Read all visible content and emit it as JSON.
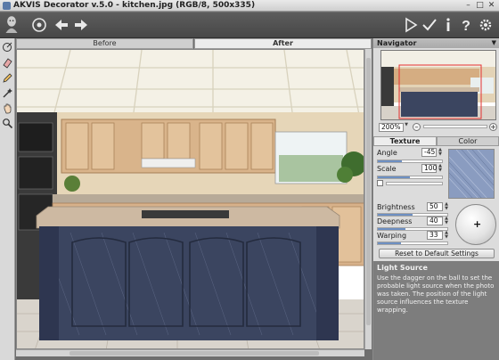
{
  "window": {
    "title": "AKVIS Decorator v.5.0 - kitchen.jpg (RGB/8, 500x335)",
    "controls": [
      "minimize",
      "maximize",
      "close"
    ]
  },
  "toolbar": {
    "left_icons": [
      "akvis-logo-icon",
      "scan-icon",
      "undo-icon",
      "redo-icon"
    ],
    "right_icons": [
      "run-icon",
      "apply-icon",
      "info-icon",
      "help-icon",
      "settings-icon"
    ]
  },
  "left_tools": [
    "decorate-brush-icon",
    "eraser-icon",
    "pencil-icon",
    "magic-wand-icon",
    "hand-icon",
    "zoom-icon"
  ],
  "view_tabs": {
    "before": "Before",
    "after": "After",
    "active": "After"
  },
  "navigator": {
    "title": "Navigator",
    "zoom": "200%"
  },
  "settings": {
    "tabs": {
      "texture": "Texture",
      "color": "Color",
      "active": "Texture"
    },
    "angle_label": "Angle",
    "angle_value": "-45",
    "angle_fraction": 0.38,
    "scale_label": "Scale",
    "scale_value": "100",
    "scale_fraction": 0.5,
    "brightness_label": "Brightness",
    "brightness_value": "50",
    "brightness_fraction": 0.5,
    "deepness_label": "Deepness",
    "deepness_value": "40",
    "deepness_fraction": 0.4,
    "warping_label": "Warping",
    "warping_value": "33",
    "warping_fraction": 0.33,
    "reset_label": "Reset to Default Settings"
  },
  "help": {
    "title": "Light Source",
    "text": "Use the dagger on the ball to set the probable light source when the photo was taken. The position of the light source influences the texture wrapping."
  },
  "colors": {
    "toolbar_bg": "#474747",
    "panel_bg": "#dcdcdc",
    "help_bg": "#7d7d7d",
    "texture_swatch": "#8a9cc0",
    "cabinet_wood": "#d9b48b",
    "island_texture": "#3b4560"
  }
}
